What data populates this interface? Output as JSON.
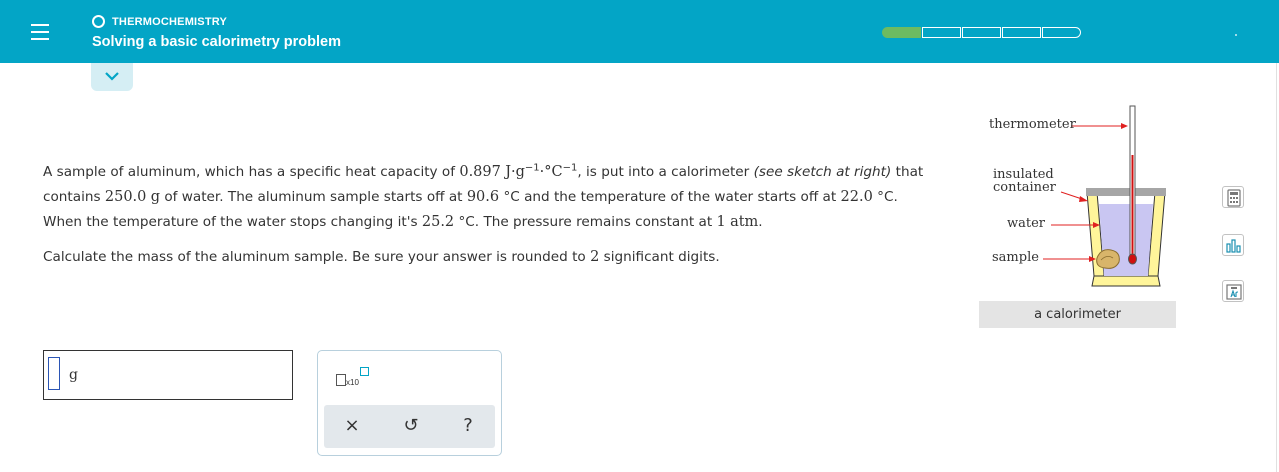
{
  "header": {
    "topic": "THERMOCHEMISTRY",
    "title": "Solving a basic calorimetry problem",
    "progress_segments": 5,
    "progress_completed": 1
  },
  "question": {
    "p1_a": "A sample of aluminum, which has a specific heat capacity of ",
    "p1_val": "0.897",
    "p1_unit_a": "J·g",
    "p1_exp1": "−1",
    "p1_unit_b": "·°C",
    "p1_exp2": "−1",
    "p1_b": ", is put into a calorimeter ",
    "p1_italic": "(see sketch at right)",
    "p1_c": " that",
    "p2_a": "contains ",
    "p2_val1": "250.0",
    "p2_unit1": "g",
    "p2_b": " of water. The aluminum sample starts off at ",
    "p2_val2": "90.6",
    "p2_unit2": "°C",
    "p2_c": " and the temperature of the water starts off at ",
    "p2_val3": "22.0",
    "p2_unit3": "°C",
    "p2_d": ".",
    "p3_a": "When the temperature of the water stops changing it's ",
    "p3_val1": "25.2",
    "p3_unit1": "°C",
    "p3_b": ". The pressure remains constant at ",
    "p3_val2": "1",
    "p3_unit2": "atm",
    "p3_c": ".",
    "calc_a": "Calculate the mass of the aluminum sample. Be sure your answer is rounded to ",
    "calc_val": "2",
    "calc_b": " significant digits."
  },
  "figure": {
    "thermometer_label": "thermometer",
    "insulated_label_1": "insulated",
    "insulated_label_2": "container",
    "water_label": "water",
    "sample_label": "sample",
    "caption": "a calorimeter"
  },
  "answer": {
    "value": "",
    "unit": "g"
  },
  "tools": {
    "x10_label": "x10",
    "clear_glyph": "×",
    "undo_glyph": "↺",
    "help_glyph": "?"
  },
  "colors": {
    "header_bg": "#03a5c6",
    "progress_done": "#6dbb61",
    "answer_cursor": "#2b55b5",
    "water": "#c9c6f2",
    "arrow": "#e02020"
  }
}
